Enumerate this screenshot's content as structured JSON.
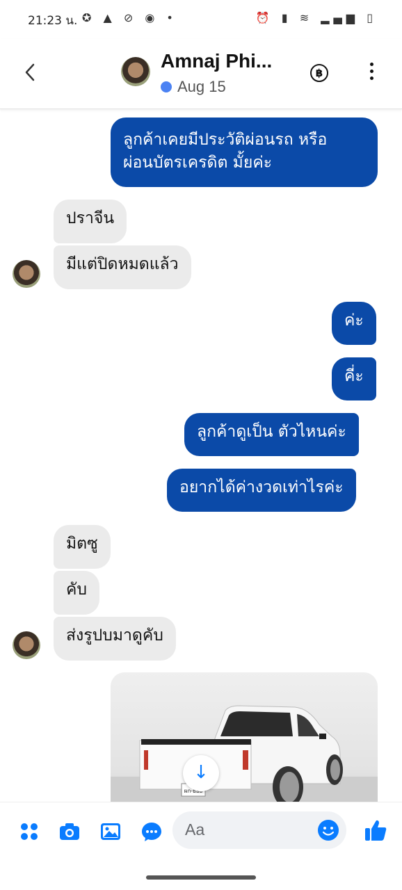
{
  "status_bar": {
    "time": "21:23 น.",
    "left_icons": "✪ ▲ ⊘ ◉ •",
    "right_icons": "⏰ ▮ ≋ ▂▄▆ ▯"
  },
  "header": {
    "contact_name": "Amnaj Phi...",
    "subtitle": "Aug 15",
    "currency_icon": "฿",
    "icons": {
      "back": "back-chevron-icon",
      "currency": "baht-coin-icon",
      "more": "more-vertical-icon"
    }
  },
  "messages": [
    {
      "id": "m1",
      "dir": "out",
      "text_line1": "ลูกค้าเคยมีประวัติผ่อนรถ หรือ",
      "text_line2": "ผ่อนบัตรเครดิต มั้ยค่ะ"
    },
    {
      "id": "m2",
      "dir": "in",
      "text": "ปราจีน"
    },
    {
      "id": "m3",
      "dir": "in",
      "text": "มีแต่ปิดหมดแล้ว"
    },
    {
      "id": "m4",
      "dir": "out",
      "text": "ค่ะ"
    },
    {
      "id": "m5",
      "dir": "out",
      "text": "คี่ะ"
    },
    {
      "id": "m6",
      "dir": "out",
      "text": "ลูกค้าดูเป็น ตัวไหนค่ะ"
    },
    {
      "id": "m7",
      "dir": "out",
      "text": "อยากได้ค่างวดเท่าไรค่ะ"
    },
    {
      "id": "m8",
      "dir": "in",
      "text": "มิตซู"
    },
    {
      "id": "m9",
      "dir": "in",
      "text": "คับ"
    },
    {
      "id": "m10",
      "dir": "in",
      "text": "ส่งรูปบมาดูคับ"
    }
  ],
  "photo": {
    "plate_text": "ผก-ยยย",
    "download_icon": "↓"
  },
  "composer": {
    "placeholder": "Aa",
    "icons": [
      "apps-grid-icon",
      "camera-icon",
      "gallery-icon",
      "chat-bubble-icon",
      "emoji-icon",
      "thumbs-up-icon"
    ]
  },
  "colors": {
    "outgoing_bubble": "#0b4aa8",
    "incoming_bubble": "#ebebeb",
    "accent": "#0a7cff",
    "online_dot": "#4b82f3"
  }
}
